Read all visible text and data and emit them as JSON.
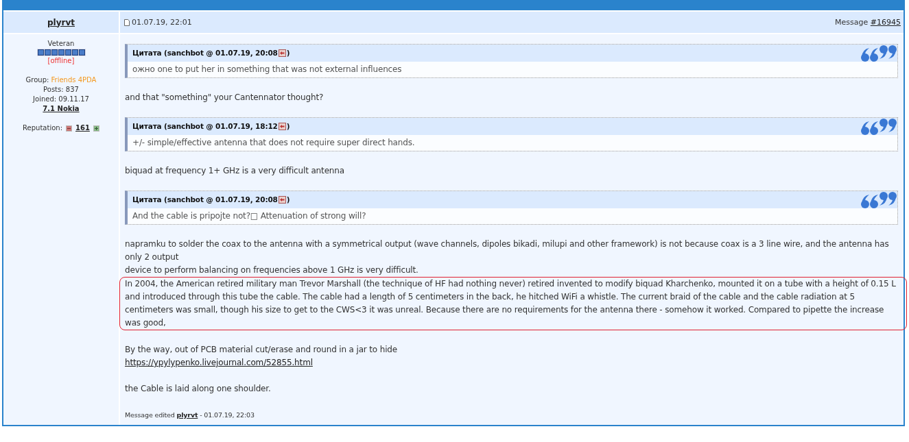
{
  "author": {
    "name": "plyrvt",
    "rank": "Veteran",
    "status": "[offline]",
    "group_label": "Group:",
    "group": "Friends 4PDA",
    "posts": "Posts: 837",
    "joined": "Joined: 09.11.17",
    "device": "7.1 Nokia",
    "reputation_label": "Reputation:",
    "reputation": "161"
  },
  "post": {
    "date": "01.07.19, 22:01",
    "message_label": "Message",
    "message_number": "#16945",
    "blocks": [
      {
        "kind": "quote",
        "header": "Цитата (sanchbot @ 01.07.19, 20:08",
        "close": ")",
        "text": "ожно one to put her in something that was not external influences"
      },
      {
        "kind": "text",
        "lines": [
          "and that \"something\" your Cantennator thought?"
        ]
      },
      {
        "kind": "quote",
        "header": "Цитата (sanchbot @ 01.07.19, 18:12",
        "close": ")",
        "text": "+/- simple/effective antenna that does not require super direct hands."
      },
      {
        "kind": "text",
        "lines": [
          "biquad at frequency 1+ GHz is a very difficult antenna"
        ]
      },
      {
        "kind": "quote",
        "header": "Цитата (sanchbot @ 01.07.19, 20:08",
        "close": ")",
        "text": "And the cable is pripojte not?□ Attenuation of strong will?"
      },
      {
        "kind": "text",
        "lines": [
          "napramku to solder the coax to the antenna with a symmetrical output (wave channels, dipoles bikadi, milupi and other framework) is not because coax is a 3 line wire, and the antenna has only 2 output",
          "device to perform balancing on frequencies above 1 GHz is very difficult."
        ]
      },
      {
        "kind": "highlight",
        "lines": [
          "In 2004, the American retired military man Trevor Marshall (the technique of HF had nothing never) retired invented to modify biquad Kharchenko, mounted it on a tube with a height of 0.15 L and introduced through this tube the cable. The cable had a length of 5 centimeters in the back, he hitched WiFi a whistle. The current braid of the cable and the cable radiation at 5 centimeters was small, though his size to get to the CWS<3 it was unreal. Because there are no requirements for the antenna there - somehow it worked. Compared to pipette the increase was good,"
        ]
      },
      {
        "kind": "text",
        "lines": [
          "By the way, out of PCB material cut/erase and round in a jar to hide"
        ],
        "link": "https://ypylypenko.livejournal.com/52855.html"
      },
      {
        "kind": "text",
        "lines": [
          "the Cable is laid along one shoulder."
        ]
      }
    ],
    "edited": {
      "label": "Message edited",
      "user": "plyrvt",
      "time": "- 01.07.19, 22:03"
    }
  }
}
